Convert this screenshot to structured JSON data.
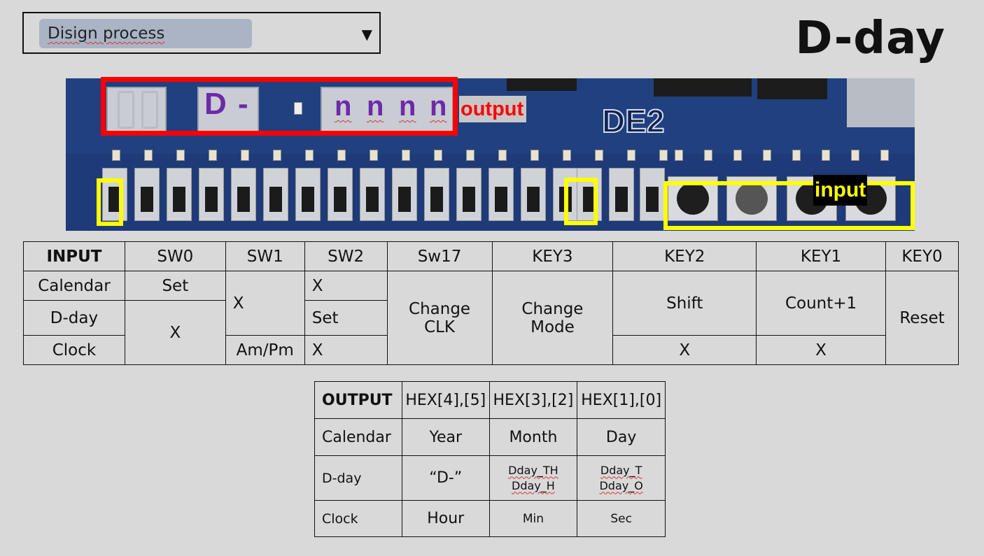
{
  "header": {
    "dropdown_value": "Disign process",
    "dropdown_arrow": "▼",
    "title": "D-day"
  },
  "board": {
    "display_chars": [
      "D",
      "-",
      "n",
      "n",
      "n",
      "n"
    ],
    "output_label": "output",
    "input_label": "input",
    "logo": "DE2",
    "colors": {
      "output_box": "#ff0000",
      "input_box": "#ffff00",
      "display_text": "#6d2aa8"
    }
  },
  "input_table": {
    "headers": [
      "INPUT",
      "SW0",
      "SW1",
      "SW2",
      "Sw17",
      "KEY3",
      "KEY2",
      "KEY1",
      "KEY0"
    ],
    "rows": {
      "calendar": {
        "label": "Calendar",
        "sw0": "Set",
        "sw2": "X"
      },
      "dday": {
        "label": "D-day",
        "sw2": "Set"
      },
      "clock": {
        "label": "Clock",
        "sw1": "Am/Pm",
        "sw2": "X",
        "key2": "X",
        "key1": "X"
      },
      "sw0_merged": "X",
      "sw1_merged": "X",
      "sw17_merged": [
        "Change",
        "CLK"
      ],
      "key3_merged": [
        "Change",
        "Mode"
      ],
      "key2_merged": "Shift",
      "key1_merged": "Count+1",
      "key0_merged": "Reset"
    }
  },
  "output_table": {
    "headers": [
      "OUTPUT",
      "HEX[4],[5]",
      "HEX[3],[2]",
      "HEX[1],[0]"
    ],
    "rows": [
      {
        "label": "Calendar",
        "c1": "Year",
        "c2": "Month",
        "c3": "Day"
      },
      {
        "label": "D-day",
        "c1": "“D-”",
        "c2a": "Dday_TH",
        "c2b": "Dday_H",
        "c3a": "Dday_T",
        "c3b": "Dday_O"
      },
      {
        "label": "Clock",
        "c1": "Hour",
        "c2": "Min",
        "c3": "Sec"
      }
    ]
  }
}
